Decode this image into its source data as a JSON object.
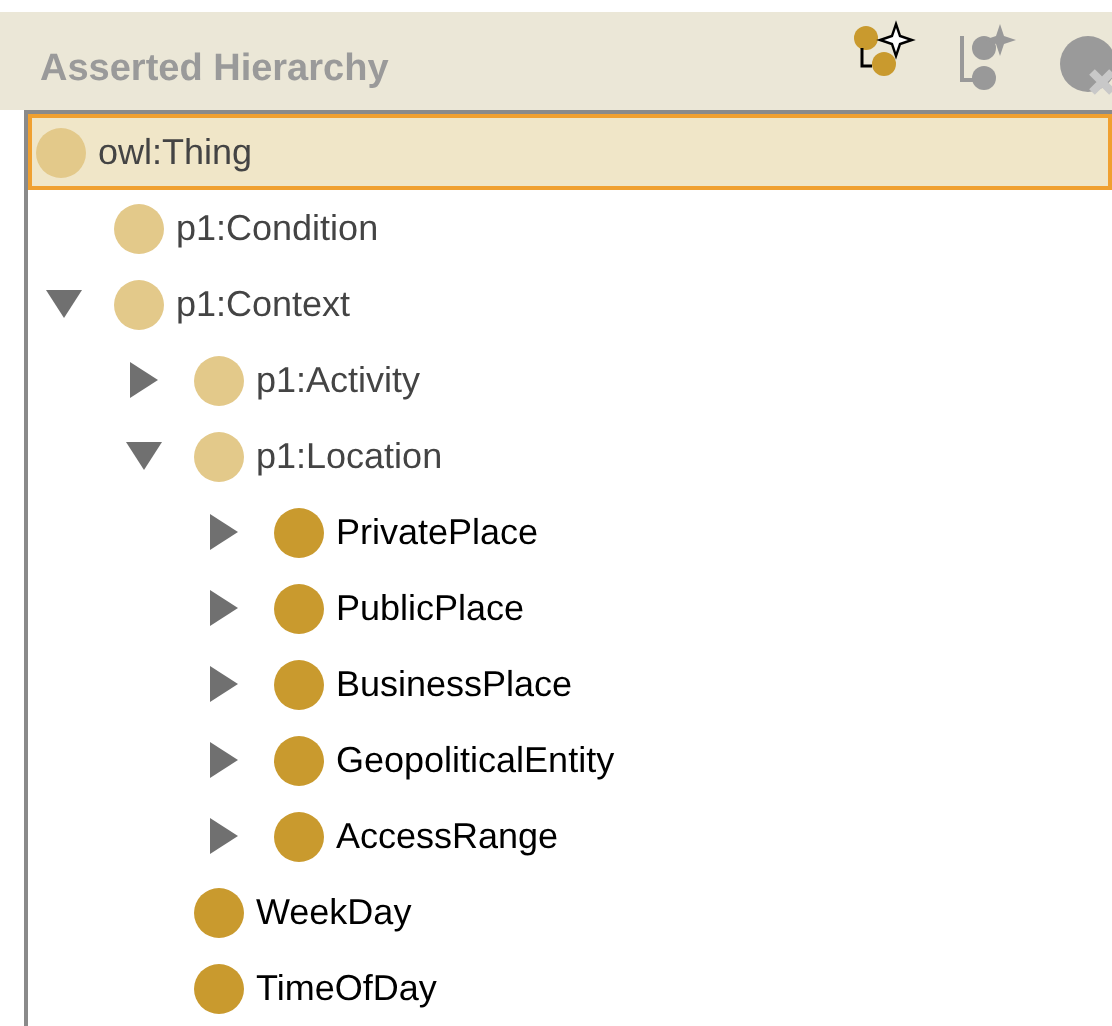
{
  "panel": {
    "title": "Asserted Hierarchy"
  },
  "tree": [
    {
      "label": "owl:Thing",
      "kind": "imported",
      "selected": true,
      "children": [
        {
          "label": "p1:Condition",
          "kind": "imported",
          "selected": false
        },
        {
          "label": "p1:Context",
          "kind": "imported",
          "expanded": true,
          "selected": false,
          "children": [
            {
              "label": "p1:Activity",
              "kind": "imported",
              "expanded": false,
              "selected": false
            },
            {
              "label": "p1:Location",
              "kind": "imported",
              "expanded": true,
              "selected": false,
              "children": [
                {
                  "label": "PrivatePlace",
                  "kind": "local",
                  "expanded": false,
                  "selected": false
                },
                {
                  "label": "PublicPlace",
                  "kind": "local",
                  "expanded": false,
                  "selected": false
                },
                {
                  "label": "BusinessPlace",
                  "kind": "local",
                  "expanded": false,
                  "selected": false
                },
                {
                  "label": "GeopoliticalEntity",
                  "kind": "local",
                  "expanded": false,
                  "selected": false
                },
                {
                  "label": "AccessRange",
                  "kind": "local",
                  "expanded": false,
                  "selected": false
                }
              ]
            },
            {
              "label": "WeekDay",
              "kind": "local",
              "selected": false
            },
            {
              "label": "TimeOfDay",
              "kind": "local",
              "selected": false
            }
          ]
        }
      ]
    }
  ]
}
